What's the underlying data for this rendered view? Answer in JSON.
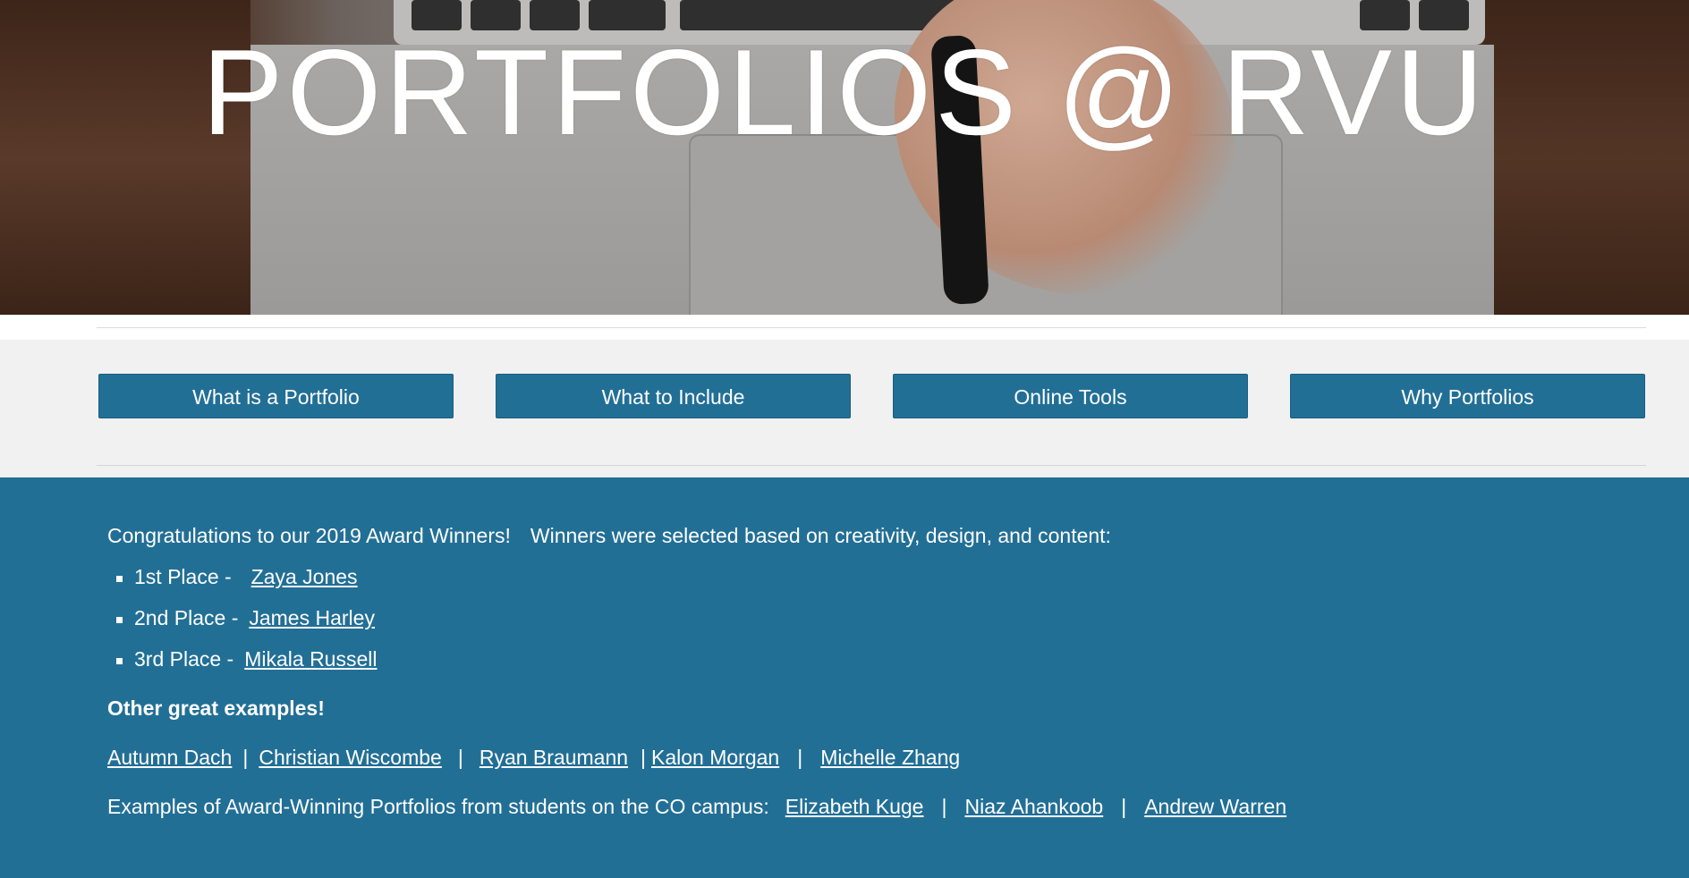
{
  "hero": {
    "title": "PORTFOLIOS @ RVU"
  },
  "nav": {
    "buttons": [
      {
        "label": "What is a Portfolio"
      },
      {
        "label": "What to Include"
      },
      {
        "label": "Online Tools"
      },
      {
        "label": "Why Portfolios"
      }
    ]
  },
  "content": {
    "intro_left": "Congratulations to our 2019 Award Winners!",
    "intro_right": "Winners were selected based on creativity, design, and content:",
    "winners": [
      {
        "place": "1st Place -",
        "name": "Zaya Jones"
      },
      {
        "place": "2nd Place -",
        "name": "James Harley"
      },
      {
        "place": "3rd Place -",
        "name": "Mikala Russell"
      }
    ],
    "other_heading": "Other great examples!",
    "others": [
      "Autumn Dach",
      "Christian Wiscombe",
      "Ryan Braumann",
      "Kalon Morgan",
      "Michelle Zhang"
    ],
    "separator": "|",
    "co_label": "Examples of Award-Winning Portfolios from students on the CO campus:",
    "co_links": [
      "Elizabeth Kuge",
      "Niaz Ahankoob",
      "Andrew Warren"
    ]
  },
  "colors": {
    "brand_blue": "#226f96",
    "nav_background": "#f1f1f1"
  }
}
